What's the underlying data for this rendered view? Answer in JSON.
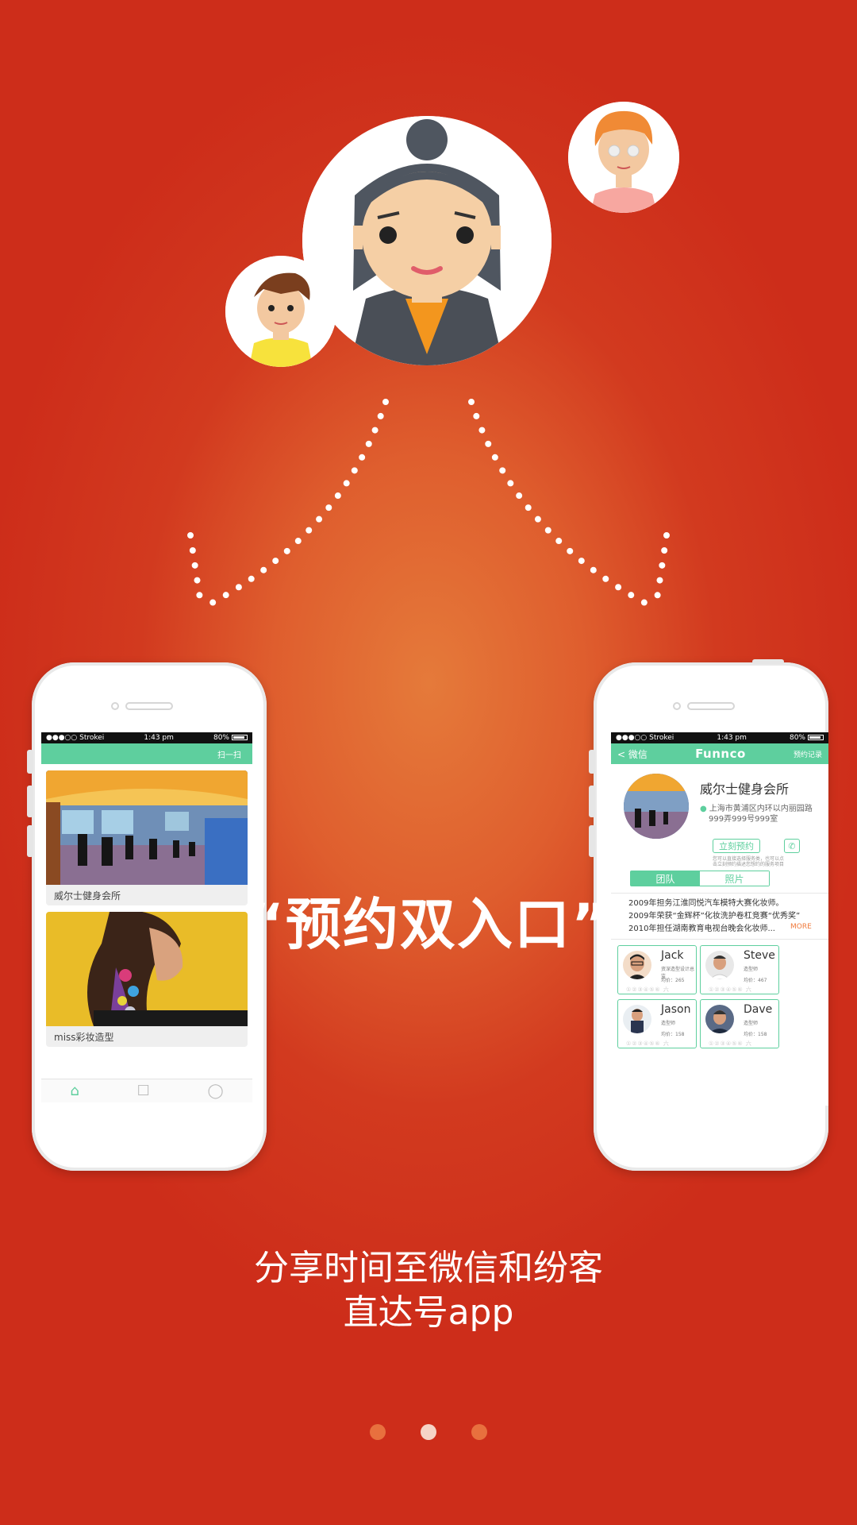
{
  "headline": "“预约双入口”",
  "subtitle_line1": "分享时间至微信和纷客",
  "subtitle_line2": "直达号app",
  "pager": {
    "count": 3,
    "active_index": 1
  },
  "left_phone": {
    "status": {
      "carrier": "●●●○○ Strokei",
      "time": "1:43 pm",
      "battery": "80%"
    },
    "nav_action": "扫一扫",
    "cards": [
      {
        "caption": "威尔士健身会所",
        "image": "gym-photo"
      },
      {
        "caption": "miss彩妆造型",
        "image": "fashion-model-photo"
      }
    ],
    "tabbar": [
      "home-icon",
      "chat-icon",
      "profile-icon"
    ]
  },
  "right_phone": {
    "status": {
      "carrier": "●●●○○ Strokei",
      "time": "1:43 pm",
      "battery": "80%"
    },
    "nav": {
      "back": "< 微信",
      "title": "Funnco",
      "right": "预约记录"
    },
    "venue": {
      "name": "威尔士健身会所",
      "address_line1": "上海市黄浦区内环以内丽园路",
      "address_line2": "999弄999号999室",
      "book_button": "立刻预约",
      "hint_line1": "您可以直接选择服务类，也可以点",
      "hint_line2": "击立刻预约描述您想约的服务项目"
    },
    "tabs": {
      "team": "团队",
      "photos": "照片"
    },
    "bio": [
      "2009年担务江淮同悦汽车模特大赛化妆师。",
      "2009年荣获“金辉杯”化妆洗护卷杠竞赛“优秀奖”",
      "2010年担任湖南教育电视台晚会化妆师..."
    ],
    "more": "MORE",
    "members": [
      {
        "name": "Jack",
        "role": "资深造型设计总监",
        "price": "均价：265",
        "stars": "①②③④⑤⑥ 六"
      },
      {
        "name": "Steve",
        "role": "造型师",
        "price": "均价：467",
        "stars": "①②③④⑤⑥ 六"
      },
      {
        "name": "Jason",
        "role": "造型师",
        "price": "均价：158",
        "stars": "①②③④⑤⑥ 六"
      },
      {
        "name": "Dave",
        "role": "造型师",
        "price": "均价：158",
        "stars": "①②③④⑤⑥ 六"
      }
    ]
  },
  "colors": {
    "accent_green": "#5ecf9e",
    "background_red": "#cd2d1a",
    "center_orange": "#e57a3a"
  }
}
